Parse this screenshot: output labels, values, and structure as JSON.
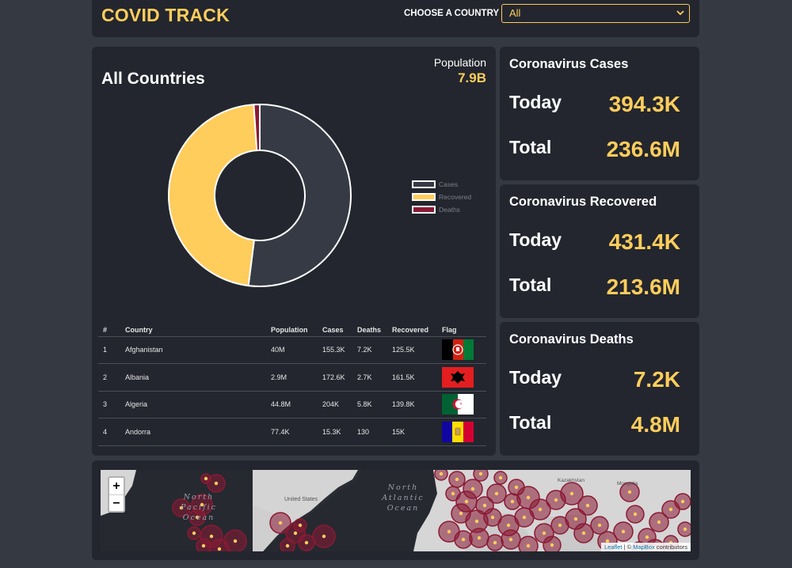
{
  "header": {
    "title": "COVID TRACK",
    "country_label": "CHOOSE A COUNTRY",
    "country_select_value": "All"
  },
  "main": {
    "region_title": "All Countries",
    "population_label": "Population",
    "population_value": "7.9B",
    "legend": [
      "Cases",
      "Recovered",
      "Deaths"
    ],
    "table": {
      "headers": [
        "#",
        "Country",
        "Population",
        "Cases",
        "Deaths",
        "Recovered",
        "Flag"
      ],
      "rows": [
        [
          "1",
          "Afghanistan",
          "40M",
          "155.3K",
          "7.2K",
          "125.5K"
        ],
        [
          "2",
          "Albania",
          "2.9M",
          "172.6K",
          "2.7K",
          "161.5K"
        ],
        [
          "3",
          "Algeria",
          "44.8M",
          "204K",
          "5.8K",
          "139.8K"
        ],
        [
          "4",
          "Andorra",
          "77.4K",
          "15.3K",
          "130",
          "15K"
        ]
      ]
    }
  },
  "chart_data": {
    "type": "pie",
    "categories": [
      "Cases",
      "Recovered",
      "Deaths"
    ],
    "values": [
      236.6,
      213.6,
      4.8
    ],
    "unit": "M",
    "legend_position": "right",
    "colors": [
      "#363a44",
      "#ffcd5c",
      "#8b1a34"
    ]
  },
  "stats": {
    "cases": {
      "title": "Coronavirus Cases",
      "today_label": "Today",
      "today_value": "394.3K",
      "total_label": "Total",
      "total_value": "236.6M"
    },
    "recovered": {
      "title": "Coronavirus Recovered",
      "today_label": "Today",
      "today_value": "431.4K",
      "total_label": "Total",
      "total_value": "213.6M"
    },
    "deaths": {
      "title": "Coronavirus Deaths",
      "today_label": "Today",
      "today_value": "7.2K",
      "total_label": "Total",
      "total_value": "4.8M"
    }
  },
  "map": {
    "zoom_in": "+",
    "zoom_out": "−",
    "ocean_north_pacific": "North Pacific Ocean",
    "ocean_north_atlantic": "North Atlantic Ocean",
    "label_united_states": "United States",
    "label_kazakhstan": "Kazakhstan",
    "label_mongolia": "Mongolia",
    "attribution_leaflet": "Leaflet",
    "attribution_sep": " | © ",
    "attribution_mapbox": "MapBox",
    "attribution_rest": " contributors"
  },
  "colors": {
    "accent": "#ffcd5c",
    "panel": "#23262e",
    "background": "#353942",
    "deaths": "#8b1a34",
    "cases": "#363a44"
  }
}
